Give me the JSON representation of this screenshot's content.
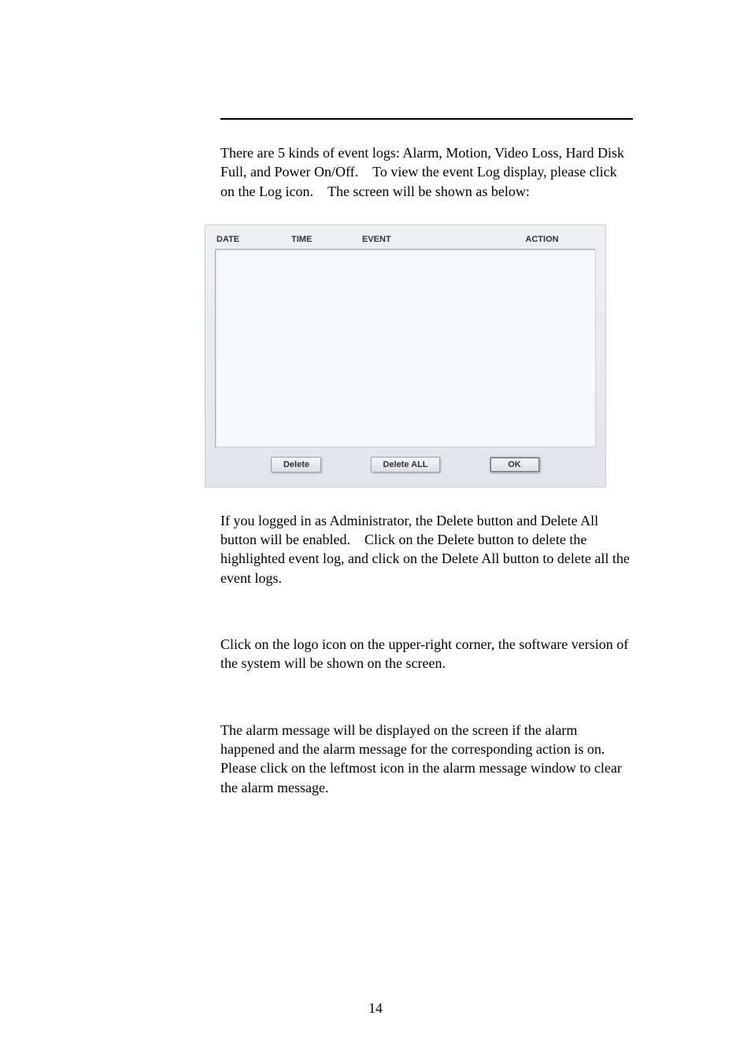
{
  "paragraphs": {
    "p1": "There are 5 kinds of event logs: Alarm, Motion, Video Loss, Hard Disk Full, and Power On/Off. To view the event Log display, please click on the Log icon. The screen will be shown as below:",
    "p2": "If you logged in as Administrator, the Delete button and Delete All button will be enabled. Click on the Delete button to delete the highlighted event log, and click on the Delete All button to delete all the event logs.",
    "p3": "Click on the logo icon on the upper-right corner, the software version of the system will be shown on the screen.",
    "p4": "The alarm message will be displayed on the screen if the alarm happened and the alarm message for the corresponding action is on. Please click on the leftmost icon in the alarm message window to clear the alarm message."
  },
  "log_window": {
    "columns": {
      "date": "DATE",
      "time": "TIME",
      "event": "EVENT",
      "action": "ACTION"
    },
    "buttons": {
      "delete": "Delete",
      "delete_all": "Delete ALL",
      "ok": "OK"
    }
  },
  "page_number": "14"
}
